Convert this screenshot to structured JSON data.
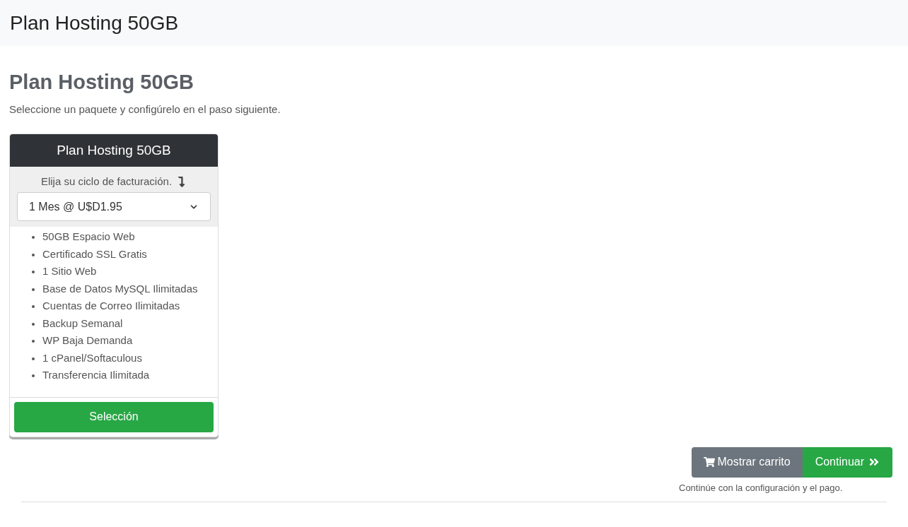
{
  "top_bar": {
    "title": "Plan Hosting 50GB"
  },
  "heading": "Plan Hosting 50GB",
  "subtitle": "Seleccione un paquete y configúrelo en el paso siguiente.",
  "product": {
    "title": "Plan Hosting 50GB",
    "cycle_label": "Elija su ciclo de facturación.",
    "cycle_value": "1 Mes @ U$D1.95",
    "features": [
      "50GB Espacio Web",
      "Certificado SSL Gratis",
      "1 Sitio Web",
      "Base de Datos MySQL Ilimitadas",
      "Cuentas de Correo Ilimitadas",
      "Backup Semanal",
      "WP Baja Demanda",
      "1 cPanel/Softaculous",
      "Transferencia Ilimitada"
    ],
    "select_button": "Selección"
  },
  "actions": {
    "cart_button": "Mostrar carrito",
    "continue_button": "Continuar",
    "note": "Continúe con la configuración y el pago."
  }
}
